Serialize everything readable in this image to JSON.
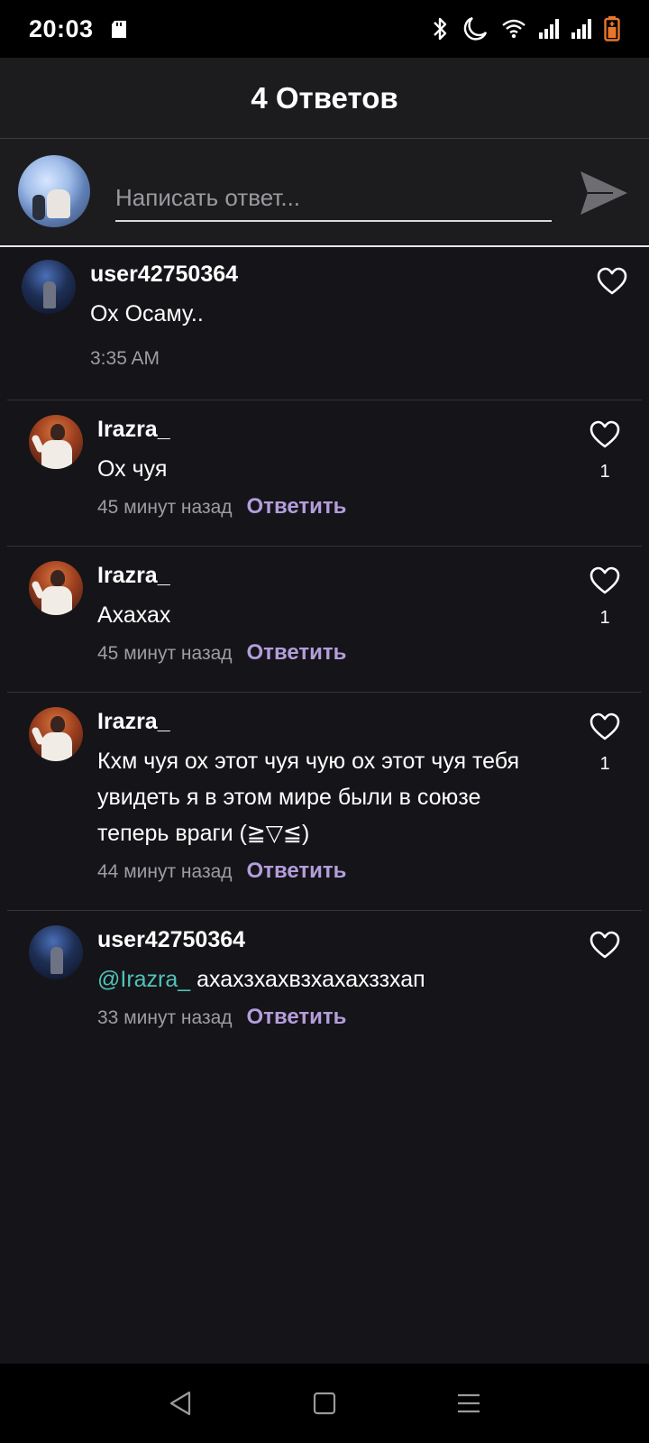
{
  "status_bar": {
    "time": "20:03",
    "icons": [
      "sd-card-icon",
      "bluetooth-icon",
      "moon-icon",
      "wifi-icon",
      "signal-icon",
      "signal-icon",
      "battery-icon"
    ]
  },
  "header": {
    "title": "4 Ответов"
  },
  "reply_box": {
    "placeholder": "Написать ответ...",
    "send_icon": "send-icon"
  },
  "comments": [
    {
      "user": "user42750364",
      "text": "Ох Осаму..",
      "time": "3:35 AM",
      "likes": ""
    },
    {
      "user": "Irazra_",
      "text": "Ох чуя",
      "time": "45 минут назад",
      "reply": "Ответить",
      "likes": "1"
    },
    {
      "user": "Irazra_",
      "text": "Ахахах",
      "time": "45 минут назад",
      "reply": "Ответить",
      "likes": "1"
    },
    {
      "user": "Irazra_",
      "text": "Кхм чуя ох этот чуя чую ох этот чуя тебя увидеть я в этом мире были в союзе теперь враги (≧▽≦)",
      "time": "44 минут назад",
      "reply": "Ответить",
      "likes": "1"
    },
    {
      "user": "user42750364",
      "mention": "@Irazra_",
      "text": " ахахзхахвзхахахззхап",
      "time": "33 минут назад",
      "reply": "Ответить",
      "likes": ""
    }
  ],
  "nav_bar": {
    "icons": [
      "back-icon",
      "home-icon",
      "menu-icon"
    ]
  },
  "colors": {
    "background": "#151418",
    "accent": "#b39ddb",
    "mention": "#4fc3b9"
  }
}
